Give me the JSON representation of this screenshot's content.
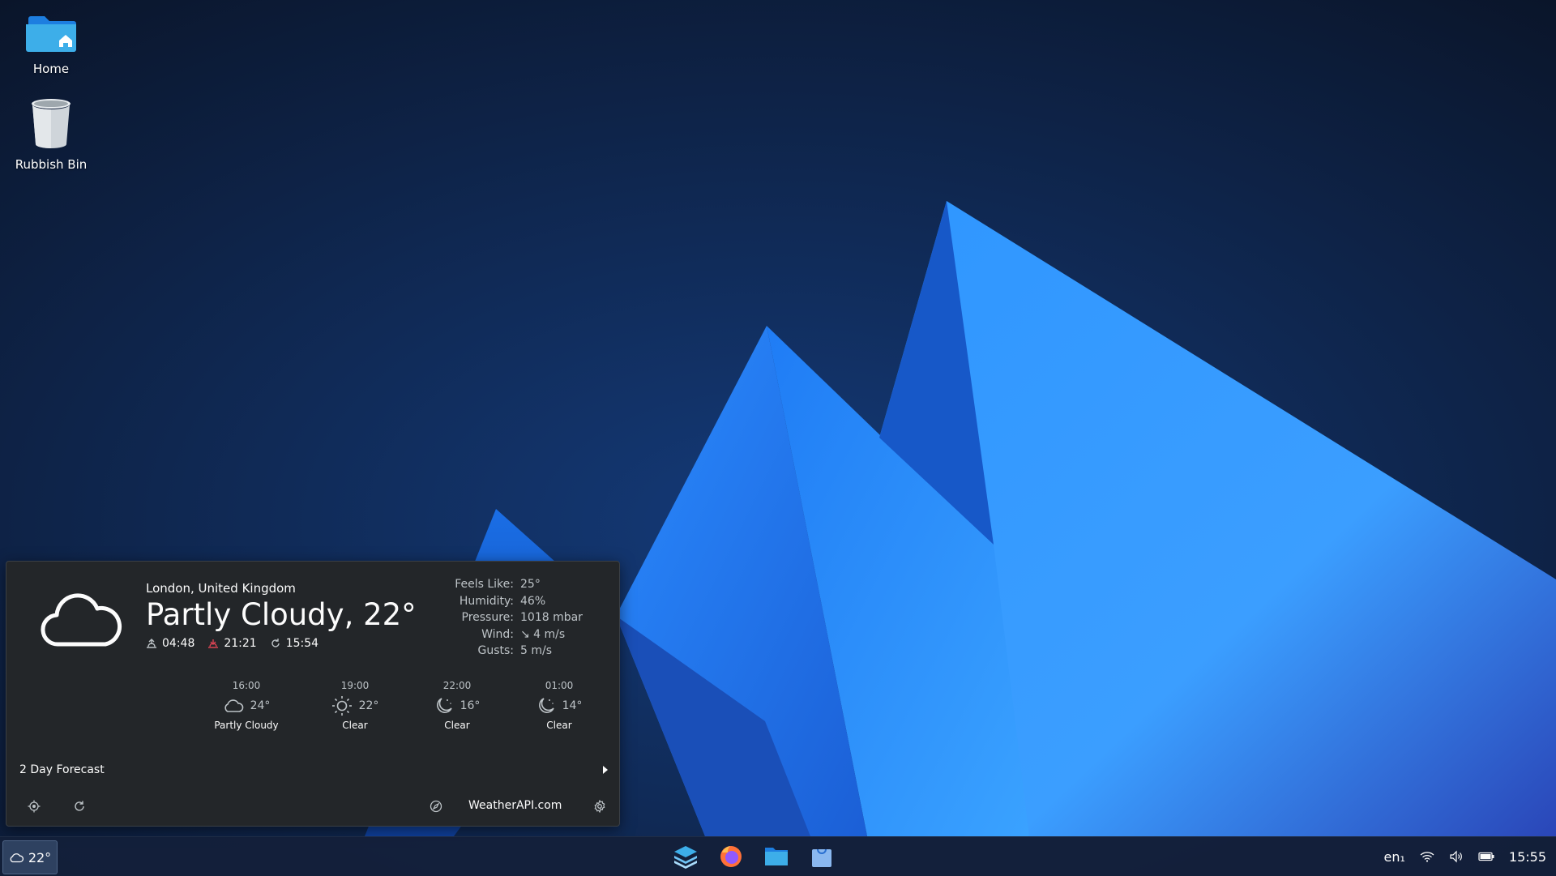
{
  "desktop": {
    "icons": [
      {
        "label": "Home",
        "icon": "folder-home-icon"
      },
      {
        "label": "Rubbish Bin",
        "icon": "trash-icon"
      }
    ]
  },
  "weather_popup": {
    "location": "London, United Kingdom",
    "headline": "Partly Cloudy, 22°",
    "sunrise": "04:48",
    "sunset": "21:21",
    "updated": "15:54",
    "details": [
      {
        "label": "Feels Like:",
        "value": "25°"
      },
      {
        "label": "Humidity:",
        "value": "46%"
      },
      {
        "label": "Pressure:",
        "value": "1018 mbar"
      },
      {
        "label": "Wind:",
        "value": "↘ 4 m/s"
      },
      {
        "label": "Gusts:",
        "value": "5 m/s"
      }
    ],
    "hourly": [
      {
        "time": "16:00",
        "temp": "24°",
        "condition": "Partly Cloudy",
        "icon": "cloud-icon"
      },
      {
        "time": "19:00",
        "temp": "22°",
        "condition": "Clear",
        "icon": "sun-icon"
      },
      {
        "time": "22:00",
        "temp": "16°",
        "condition": "Clear",
        "icon": "moon-icon"
      },
      {
        "time": "01:00",
        "temp": "14°",
        "condition": "Clear",
        "icon": "moon-icon"
      }
    ],
    "forecast_label": "2 Day Forecast",
    "source": "WeatherAPI.com"
  },
  "taskbar": {
    "weather_temp": "22°",
    "language": "en₁",
    "clock": "15:55",
    "launchers": [
      "app-launcher-icon",
      "firefox-icon",
      "file-manager-icon",
      "software-store-icon"
    ]
  },
  "colors": {
    "accent": "#1d99f3",
    "popup_bg": "#232629",
    "taskbar_bg": "#14203a"
  }
}
